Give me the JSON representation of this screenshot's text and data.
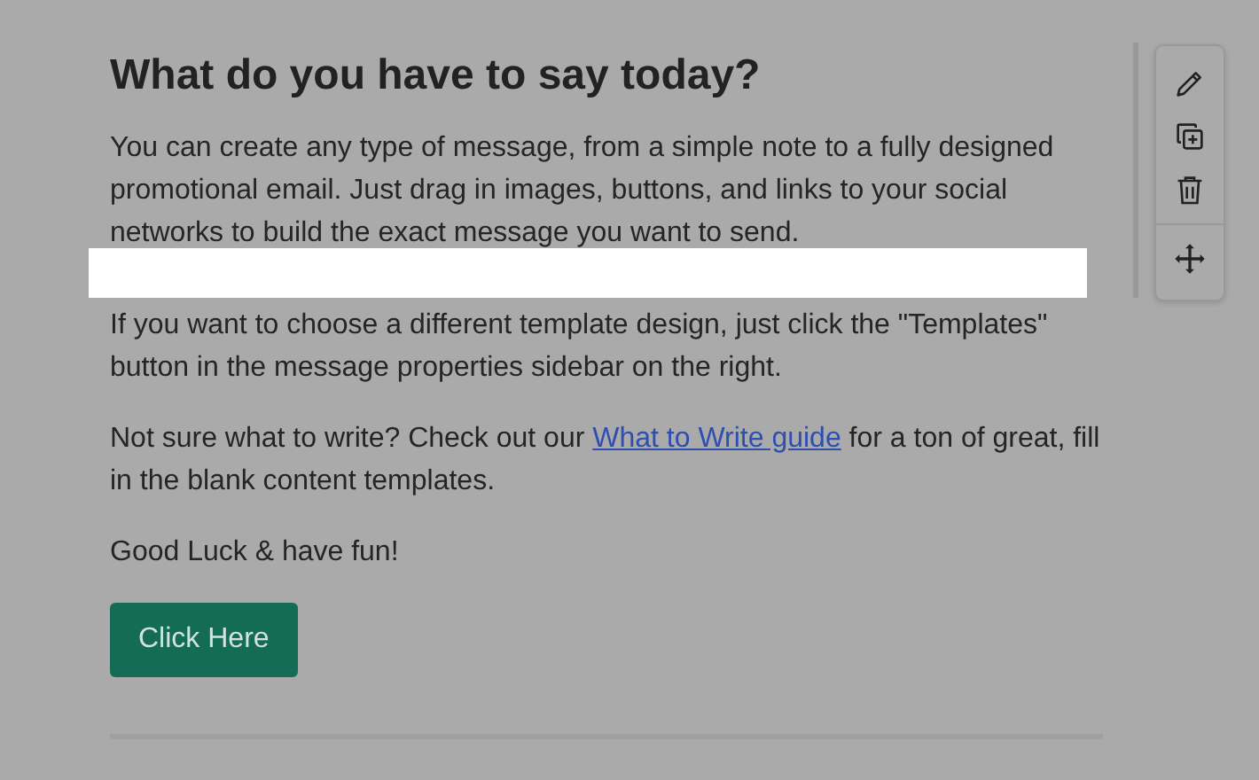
{
  "heading": "What do you have to say today?",
  "paragraphs": [
    {
      "kind": "text",
      "text": "You can create any type of message, from a simple note to a fully designed promotional email. Just drag in images, buttons, and links to your social networks to build the exact message you want to send."
    },
    {
      "kind": "blank"
    },
    {
      "kind": "text",
      "text": "If you want to choose a different template design, just click the \"Templates\" button in the message properties sidebar on the right."
    },
    {
      "kind": "link",
      "before": "Not sure what to write? Check out our ",
      "link": "What to Write guide",
      "after": " for a ton of great, fill in the blank content templates."
    },
    {
      "kind": "text",
      "text": "Good Luck & have fun!"
    }
  ],
  "button": "Click Here",
  "toolbar": [
    {
      "kind": "edit"
    },
    {
      "kind": "duplicate"
    },
    {
      "kind": "delete"
    },
    {
      "kind": "move"
    }
  ]
}
